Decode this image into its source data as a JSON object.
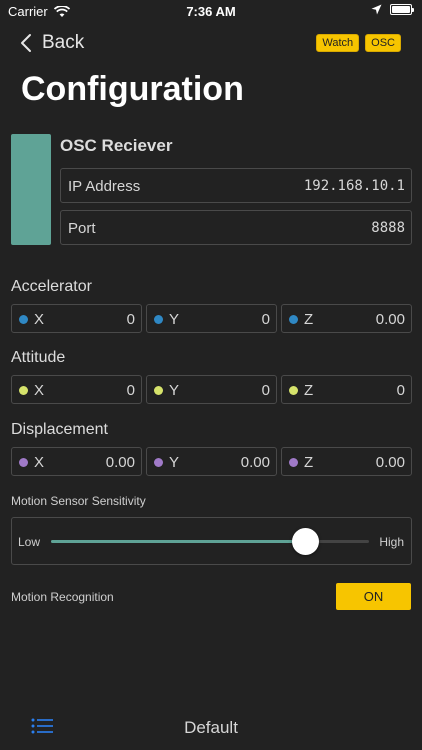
{
  "status": {
    "carrier": "Carrier",
    "time": "7:36 AM"
  },
  "nav": {
    "back_label": "Back",
    "badges": [
      "Watch",
      "OSC"
    ]
  },
  "title": "Configuration",
  "osc": {
    "title": "OSC Reciever",
    "ip_label": "IP Address",
    "ip_value": "192.168.10.1",
    "port_label": "Port",
    "port_value": "8888",
    "swatch_color": "#5fa396"
  },
  "accelerator": {
    "label": "Accelerator",
    "color": "#2f88c4",
    "values": [
      {
        "axis": "X",
        "value": "0"
      },
      {
        "axis": "Y",
        "value": "0"
      },
      {
        "axis": "Z",
        "value": "0.00"
      }
    ]
  },
  "attitude": {
    "label": "Attitude",
    "color": "#d6e36b",
    "values": [
      {
        "axis": "X",
        "value": "0"
      },
      {
        "axis": "Y",
        "value": "0"
      },
      {
        "axis": "Z",
        "value": "0"
      }
    ]
  },
  "displacement": {
    "label": "Displacement",
    "color": "#a07ac8",
    "values": [
      {
        "axis": "X",
        "value": "0.00"
      },
      {
        "axis": "Y",
        "value": "0.00"
      },
      {
        "axis": "Z",
        "value": "0.00"
      }
    ]
  },
  "sensitivity": {
    "label": "Motion Sensor Sensitivity",
    "low": "Low",
    "high": "High",
    "level": 0.8
  },
  "recognition": {
    "label": "Motion Recognition",
    "toggle": "ON"
  },
  "tabbar": {
    "default_label": "Default"
  },
  "colors": {
    "accent": "#f7c500",
    "teal": "#5fa396",
    "tab_icon": "#2b7ff0"
  }
}
